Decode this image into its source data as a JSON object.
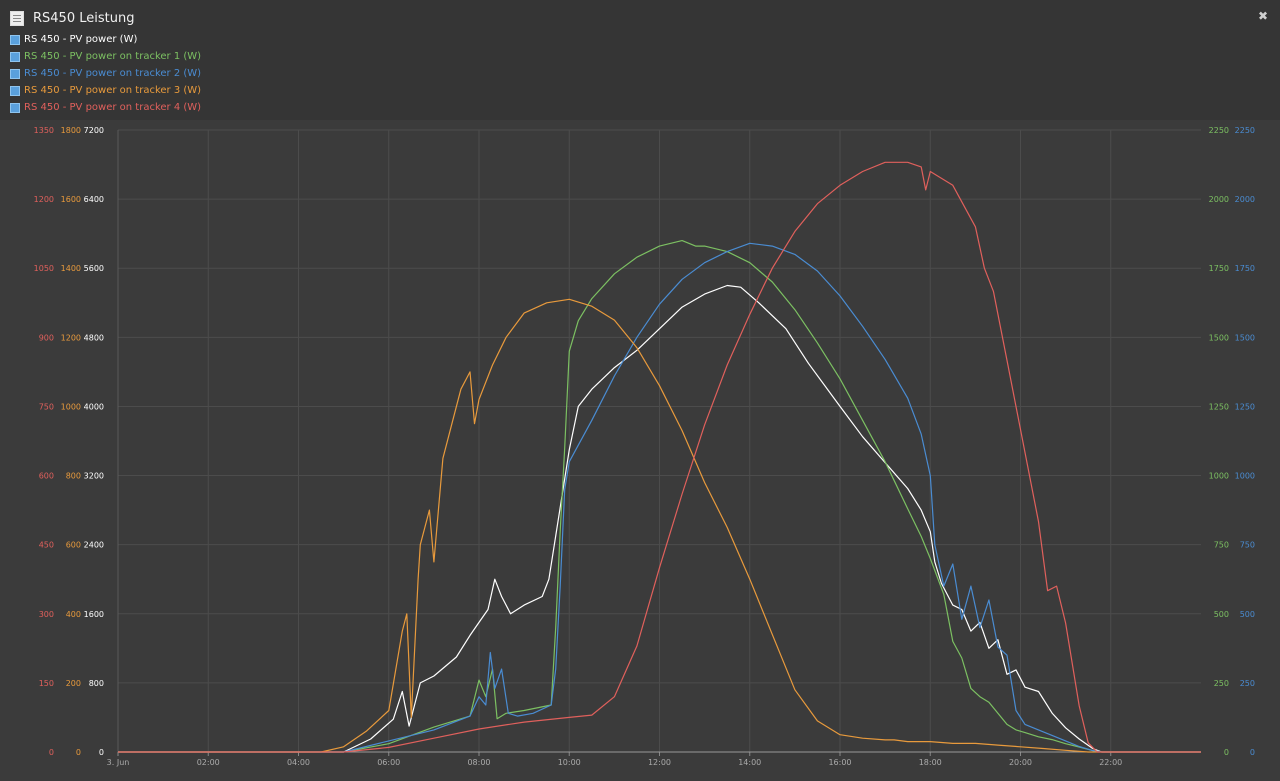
{
  "header": {
    "title": "RS450 Leistung",
    "collapse_icon": "collapse-icon"
  },
  "legend": [
    {
      "label": "RS 450 - PV power (W)",
      "color": "#ffffff"
    },
    {
      "label": "RS 450 - PV power on tracker 1 (W)",
      "color": "#7cc062"
    },
    {
      "label": "RS 450 - PV power on tracker 2 (W)",
      "color": "#4a8cd2"
    },
    {
      "label": "RS 450 - PV power on tracker 3 (W)",
      "color": "#e89a3c"
    },
    {
      "label": "RS 450 - PV power on tracker 4 (W)",
      "color": "#e0605c"
    }
  ],
  "chart_data": {
    "type": "line",
    "x_ticks": [
      "3. Jun",
      "02:00",
      "04:00",
      "06:00",
      "08:00",
      "10:00",
      "12:00",
      "14:00",
      "16:00",
      "18:00",
      "20:00",
      "22:00"
    ],
    "xlim": [
      0,
      24
    ],
    "grid": true,
    "axes": [
      {
        "id": "tracker4",
        "side": "left",
        "color": "#e0605c",
        "ylim": [
          0,
          1350
        ],
        "ticks": [
          "0",
          "150",
          "300",
          "450",
          "600",
          "750",
          "900",
          "1050",
          "1200",
          "1350"
        ]
      },
      {
        "id": "tracker3",
        "side": "left",
        "color": "#e89a3c",
        "ylim": [
          0,
          1800
        ],
        "ticks": [
          "0",
          "200",
          "400",
          "600",
          "800",
          "1000",
          "1200",
          "1400",
          "1600",
          "1800"
        ]
      },
      {
        "id": "total",
        "side": "left",
        "color": "#ffffff",
        "ylim": [
          0,
          7200
        ],
        "ticks": [
          "0",
          "800",
          "1600",
          "2400",
          "3200",
          "4000",
          "4800",
          "5600",
          "6400",
          "7200"
        ]
      },
      {
        "id": "tracker1",
        "side": "right",
        "color": "#7cc062",
        "ylim": [
          0,
          2250
        ],
        "ticks": [
          "0",
          "250",
          "500",
          "750",
          "1000",
          "1250",
          "1500",
          "1750",
          "2000",
          "2250"
        ]
      },
      {
        "id": "tracker2",
        "side": "right",
        "color": "#4a8cd2",
        "ylim": [
          0,
          2250
        ],
        "ticks": [
          "0",
          "250",
          "500",
          "750",
          "1000",
          "1250",
          "1500",
          "1750",
          "2000",
          "2250"
        ]
      }
    ],
    "series": [
      {
        "name": "RS 450 - PV power (W)",
        "axis": "total",
        "color": "#ffffff",
        "x": [
          0,
          5,
          5.6,
          6.1,
          6.3,
          6.45,
          6.7,
          7,
          7.5,
          7.8,
          8,
          8.2,
          8.35,
          8.5,
          8.7,
          9,
          9.4,
          9.55,
          9.7,
          9.85,
          10,
          10.2,
          10.5,
          11,
          11.5,
          12,
          12.5,
          13,
          13.5,
          13.8,
          14.2,
          14.8,
          15.3,
          16,
          16.5,
          17,
          17.5,
          17.8,
          18,
          18.1,
          18.25,
          18.4,
          18.5,
          18.7,
          18.9,
          19.1,
          19.3,
          19.5,
          19.7,
          19.9,
          20.1,
          20.4,
          20.7,
          21,
          21.3,
          21.6,
          21.8,
          22,
          24
        ],
        "y": [
          0,
          0,
          150,
          380,
          700,
          300,
          800,
          880,
          1100,
          1350,
          1500,
          1650,
          2000,
          1800,
          1600,
          1700,
          1800,
          2000,
          2500,
          3000,
          3500,
          4000,
          4200,
          4450,
          4650,
          4900,
          5150,
          5300,
          5400,
          5380,
          5200,
          4900,
          4500,
          4000,
          3650,
          3350,
          3050,
          2800,
          2550,
          2200,
          1950,
          1800,
          1700,
          1650,
          1400,
          1500,
          1200,
          1300,
          900,
          950,
          750,
          700,
          450,
          280,
          150,
          40,
          0,
          0,
          0
        ]
      },
      {
        "name": "RS 450 - PV power on tracker 1 (W)",
        "axis": "tracker1",
        "color": "#7cc062",
        "x": [
          0,
          5,
          6,
          7,
          7.8,
          8,
          8.15,
          8.3,
          8.4,
          8.6,
          9,
          9.6,
          9.7,
          9.8,
          9.9,
          10,
          10.2,
          10.5,
          11,
          11.5,
          12,
          12.5,
          12.8,
          13,
          13.5,
          14,
          14.5,
          15,
          15.5,
          16,
          16.5,
          17,
          17.5,
          17.8,
          18,
          18.3,
          18.5,
          18.7,
          18.9,
          19.1,
          19.3,
          19.5,
          19.7,
          19.9,
          20.1,
          20.4,
          20.7,
          21,
          21.3,
          21.6,
          21.8,
          22,
          24
        ],
        "y": [
          0,
          0,
          30,
          90,
          130,
          260,
          200,
          300,
          120,
          140,
          150,
          170,
          450,
          800,
          1100,
          1450,
          1560,
          1640,
          1730,
          1790,
          1830,
          1850,
          1830,
          1830,
          1810,
          1770,
          1700,
          1600,
          1480,
          1350,
          1200,
          1050,
          880,
          780,
          700,
          570,
          400,
          340,
          230,
          200,
          180,
          140,
          100,
          80,
          70,
          55,
          45,
          30,
          18,
          5,
          0,
          0,
          0
        ]
      },
      {
        "name": "RS 450 - PV power on tracker 2 (W)",
        "axis": "tracker2",
        "color": "#4a8cd2",
        "x": [
          0,
          5,
          6,
          7,
          7.8,
          8,
          8.15,
          8.25,
          8.35,
          8.5,
          8.65,
          8.85,
          9.2,
          9.6,
          9.7,
          9.8,
          9.9,
          10,
          10.5,
          11,
          11.5,
          12,
          12.5,
          13,
          13.5,
          14,
          14.5,
          15,
          15.5,
          16,
          16.5,
          17,
          17.5,
          17.8,
          18,
          18.1,
          18.3,
          18.5,
          18.7,
          18.9,
          19.1,
          19.3,
          19.5,
          19.7,
          19.9,
          20.1,
          20.4,
          20.7,
          21,
          21.3,
          21.6,
          21.8,
          22,
          24
        ],
        "y": [
          0,
          0,
          40,
          80,
          130,
          200,
          170,
          360,
          230,
          300,
          140,
          130,
          140,
          170,
          300,
          600,
          950,
          1050,
          1200,
          1360,
          1500,
          1620,
          1710,
          1770,
          1810,
          1840,
          1830,
          1800,
          1740,
          1650,
          1540,
          1420,
          1280,
          1150,
          1000,
          750,
          600,
          680,
          480,
          600,
          450,
          550,
          380,
          350,
          150,
          100,
          80,
          60,
          40,
          20,
          5,
          0,
          0,
          0
        ]
      },
      {
        "name": "RS 450 - PV power on tracker 3 (W)",
        "axis": "tracker3",
        "color": "#e89a3c",
        "x": [
          0,
          4.5,
          5,
          5.5,
          6,
          6.3,
          6.4,
          6.5,
          6.65,
          6.7,
          6.9,
          7,
          7.2,
          7.4,
          7.6,
          7.8,
          7.9,
          8,
          8.3,
          8.6,
          9,
          9.5,
          10,
          10.5,
          11,
          11.5,
          12,
          12.5,
          13,
          13.5,
          14,
          14.5,
          15,
          15.5,
          16,
          16.5,
          17,
          17.2,
          17.5,
          18,
          18.5,
          19,
          19.5,
          20,
          20.5,
          21,
          21.5,
          21.7,
          22,
          24
        ],
        "y": [
          0,
          0,
          15,
          60,
          120,
          350,
          400,
          100,
          500,
          600,
          700,
          550,
          850,
          950,
          1050,
          1100,
          950,
          1020,
          1120,
          1200,
          1270,
          1300,
          1310,
          1290,
          1250,
          1170,
          1060,
          930,
          780,
          650,
          500,
          340,
          180,
          90,
          50,
          40,
          35,
          35,
          30,
          30,
          25,
          25,
          20,
          15,
          10,
          5,
          0,
          0,
          0,
          0
        ]
      },
      {
        "name": "RS 450 - PV power on tracker 4 (W)",
        "axis": "tracker4",
        "color": "#e0605c",
        "x": [
          0,
          5,
          6,
          7,
          8,
          9,
          10,
          10.5,
          11,
          11.5,
          12,
          12.5,
          13,
          13.5,
          14,
          14.5,
          15,
          15.5,
          16,
          16.5,
          17,
          17.5,
          17.8,
          17.9,
          18,
          18.5,
          19,
          19.2,
          19.4,
          19.7,
          20,
          20.4,
          20.6,
          20.8,
          21,
          21.3,
          21.5,
          21.7,
          22,
          24
        ],
        "y": [
          0,
          0,
          10,
          30,
          50,
          65,
          75,
          80,
          120,
          230,
          400,
          560,
          710,
          840,
          950,
          1050,
          1130,
          1190,
          1230,
          1260,
          1280,
          1280,
          1270,
          1220,
          1260,
          1230,
          1140,
          1050,
          1000,
          850,
          700,
          500,
          350,
          360,
          280,
          100,
          20,
          0,
          0,
          0
        ]
      }
    ]
  }
}
